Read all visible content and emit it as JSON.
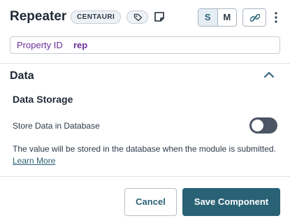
{
  "header": {
    "title": "Repeater",
    "badge": "CENTAURI",
    "tag_icon": "tag-icon",
    "note_icon": "note-icon",
    "modes": [
      "S",
      "M"
    ],
    "active_mode": "S",
    "link_icon": "link-icon",
    "more_icon": "kebab-menu-icon"
  },
  "property": {
    "label": "Property ID",
    "value": "rep"
  },
  "section": {
    "title": "Data",
    "expanded": true,
    "subsection_title": "Data Storage",
    "store_label": "Store Data in Database",
    "store_enabled": false,
    "description": "The value will be stored in the database when the module is submitted.",
    "learn_more": "Learn More"
  },
  "footer": {
    "cancel_label": "Cancel",
    "save_label": "Save Component"
  },
  "colors": {
    "accent": "#2a6275",
    "property_text": "#6b2f9b",
    "toggle_off": "#4b5563"
  }
}
